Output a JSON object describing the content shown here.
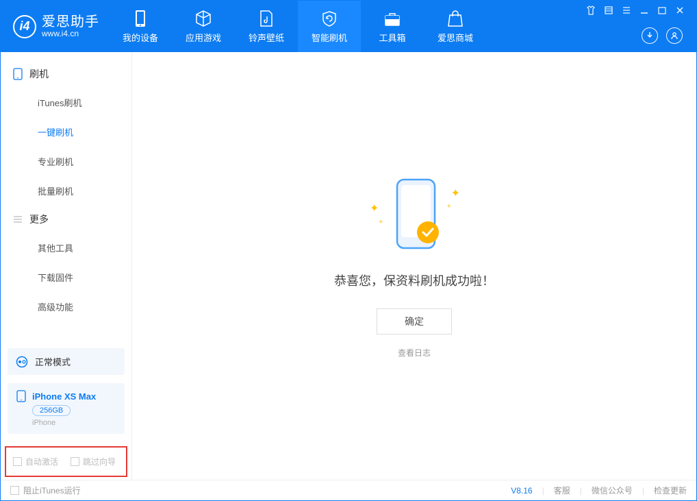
{
  "app": {
    "name_cn": "爱思助手",
    "url": "www.i4.cn"
  },
  "tabs": [
    {
      "label": "我的设备"
    },
    {
      "label": "应用游戏"
    },
    {
      "label": "铃声壁纸"
    },
    {
      "label": "智能刷机"
    },
    {
      "label": "工具箱"
    },
    {
      "label": "爱思商城"
    }
  ],
  "sidebar": {
    "group1_title": "刷机",
    "items1": [
      "iTunes刷机",
      "一键刷机",
      "专业刷机",
      "批量刷机"
    ],
    "group2_title": "更多",
    "items2": [
      "其他工具",
      "下载固件",
      "高级功能"
    ]
  },
  "device_mode": "正常模式",
  "device": {
    "name": "iPhone XS Max",
    "capacity": "256GB",
    "type": "iPhone"
  },
  "options": {
    "auto_activate": "自动激活",
    "skip_guide": "跳过向导"
  },
  "main": {
    "success_text": "恭喜您，保资料刷机成功啦！",
    "ok": "确定",
    "view_log": "查看日志"
  },
  "footer": {
    "block_itunes": "阻止iTunes运行",
    "version": "V8.16",
    "links": [
      "客服",
      "微信公众号",
      "检查更新"
    ]
  }
}
